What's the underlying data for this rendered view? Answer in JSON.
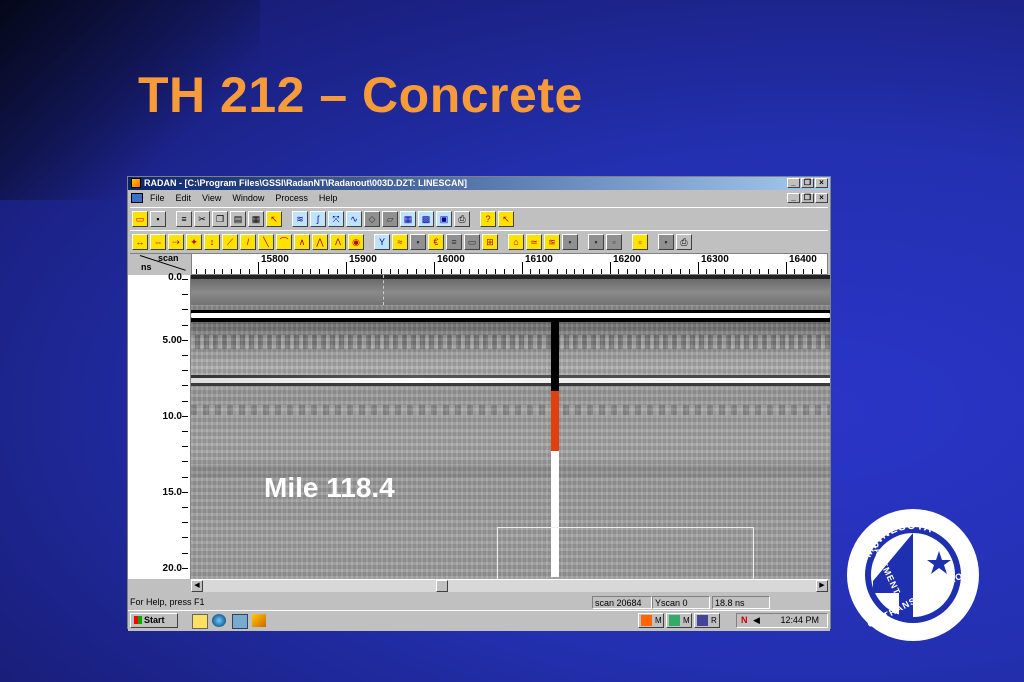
{
  "slide": {
    "title": "TH 212 – Concrete",
    "annotation": "Mile 118.4"
  },
  "window": {
    "title": "RADAN - [C:\\Program Files\\GSSI\\RadanNT\\Radanout\\003D.DZT:  LINESCAN]",
    "menu": [
      "File",
      "Edit",
      "View",
      "Window",
      "Process",
      "Help"
    ],
    "controls": {
      "minimize": "_",
      "restore": "❐",
      "close": "×"
    }
  },
  "ruler": {
    "scan_label": "scan",
    "ns_label": "ns",
    "marks": [
      "15800",
      "15900",
      "16000",
      "16100",
      "16200",
      "16300",
      "16400"
    ]
  },
  "yaxis": {
    "labels": [
      "0.0",
      "5.00",
      "10.0",
      "15.0",
      "20.0"
    ]
  },
  "statusbar": {
    "help": "For Help, press F1",
    "scan": "scan 20684",
    "yscan": "Yscan 0",
    "depth": "18.8 ns"
  },
  "taskbar": {
    "start": "Start",
    "tasks": [
      "M",
      "M",
      "R"
    ],
    "tray_flag": "N",
    "clock": "12:44 PM"
  },
  "logo": {
    "top_text": "MINNESOTA",
    "left_text": "DEPARTMENT",
    "bottom_text": "OF TRANSPORTATION",
    "numeral": "4"
  }
}
